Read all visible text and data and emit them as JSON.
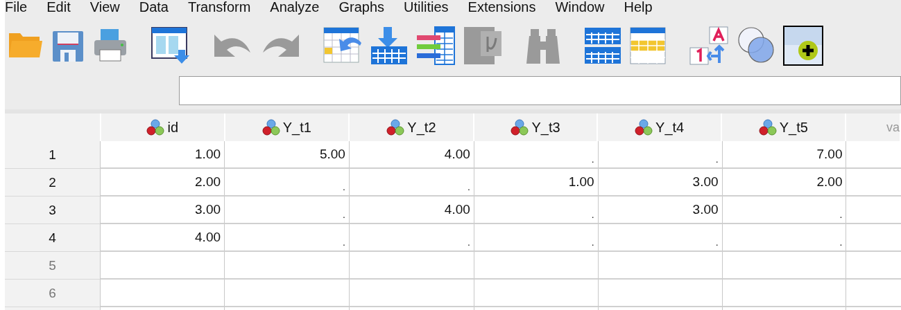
{
  "menu": [
    {
      "label": "File"
    },
    {
      "label": "Edit"
    },
    {
      "label": "View"
    },
    {
      "label": "Data"
    },
    {
      "label": "Transform"
    },
    {
      "label": "Analyze"
    },
    {
      "label": "Graphs"
    },
    {
      "label": "Utilities"
    },
    {
      "label": "Extensions"
    },
    {
      "label": "Window"
    },
    {
      "label": "Help"
    }
  ],
  "toolbar": [
    {
      "kind": "open",
      "disabled": false
    },
    {
      "kind": "save",
      "disabled": false
    },
    {
      "kind": "print",
      "disabled": false
    },
    {
      "kind": "recall",
      "disabled": false
    },
    {
      "kind": "undo",
      "disabled": true
    },
    {
      "kind": "redo",
      "disabled": true
    },
    {
      "kind": "gotocase",
      "disabled": false
    },
    {
      "kind": "gotovar",
      "disabled": false
    },
    {
      "kind": "variables",
      "disabled": false
    },
    {
      "kind": "stats",
      "disabled": true
    },
    {
      "kind": "find",
      "disabled": true
    },
    {
      "kind": "split",
      "disabled": false
    },
    {
      "kind": "select",
      "disabled": false
    },
    {
      "kind": "labels",
      "disabled": false
    },
    {
      "kind": "sets",
      "disabled": false
    },
    {
      "kind": "addon",
      "disabled": false
    }
  ],
  "grid": {
    "columns": [
      {
        "name": "id",
        "kind": "scale"
      },
      {
        "name": "Y_t1",
        "kind": "scale"
      },
      {
        "name": "Y_t2",
        "kind": "scale"
      },
      {
        "name": "Y_t3",
        "kind": "scale"
      },
      {
        "name": "Y_t4",
        "kind": "scale"
      },
      {
        "name": "Y_t5",
        "kind": "scale"
      },
      {
        "name": "va",
        "kind": "empty"
      }
    ],
    "rows": [
      {
        "number": "1",
        "has_data": true,
        "cells": [
          "1.00",
          "5.00",
          "4.00",
          ".",
          ".",
          "7.00"
        ]
      },
      {
        "number": "2",
        "has_data": true,
        "cells": [
          "2.00",
          ".",
          ".",
          "1.00",
          "3.00",
          "2.00"
        ]
      },
      {
        "number": "3",
        "has_data": true,
        "cells": [
          "3.00",
          ".",
          "4.00",
          ".",
          "3.00",
          "."
        ]
      },
      {
        "number": "4",
        "has_data": true,
        "cells": [
          "4.00",
          ".",
          ".",
          ".",
          ".",
          "."
        ]
      },
      {
        "number": "5",
        "has_data": false,
        "cells": []
      },
      {
        "number": "6",
        "has_data": false,
        "cells": []
      }
    ]
  }
}
